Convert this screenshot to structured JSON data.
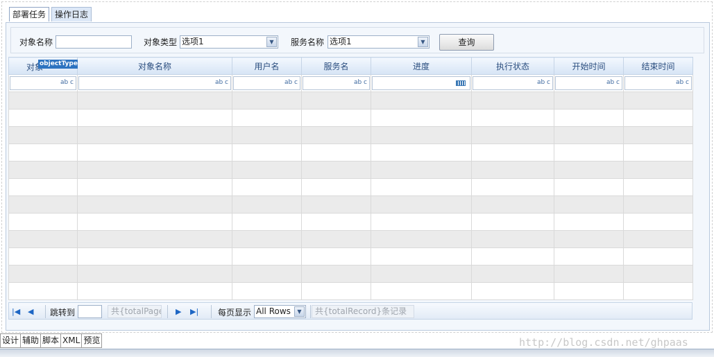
{
  "tabs": [
    {
      "label": "部署任务",
      "active": true
    },
    {
      "label": "操作日志",
      "active": false
    }
  ],
  "query": {
    "object_name_label": "对象名称",
    "object_name_value": "",
    "object_type_label": "对象类型",
    "object_type_value": "选项1",
    "service_name_label": "服务名称",
    "service_name_value": "选项1",
    "search_button": "查询"
  },
  "grid": {
    "column_tag": "objectType",
    "columns": [
      "对象",
      "对象名称",
      "用户名",
      "服务名",
      "进度",
      "执行状态",
      "开始时间",
      "结束时间"
    ],
    "filter_hint": "ab c",
    "row_count": 12
  },
  "pager": {
    "jump_label": "跳转到",
    "jump_value": "",
    "total_pages": "共{totalPage",
    "per_page_label": "每页显示",
    "per_page_value": "All Rows",
    "total_records": "共{totalRecord}条记录"
  },
  "bottom_tabs": [
    "设计",
    "辅助",
    "脚本",
    "XML",
    "预览"
  ],
  "watermark": "http://blog.csdn.net/ghpaas",
  "colors": {
    "header_text": "#2b4e7f",
    "accent_blue": "#2d73c0",
    "row_alt": "#ebebeb"
  }
}
